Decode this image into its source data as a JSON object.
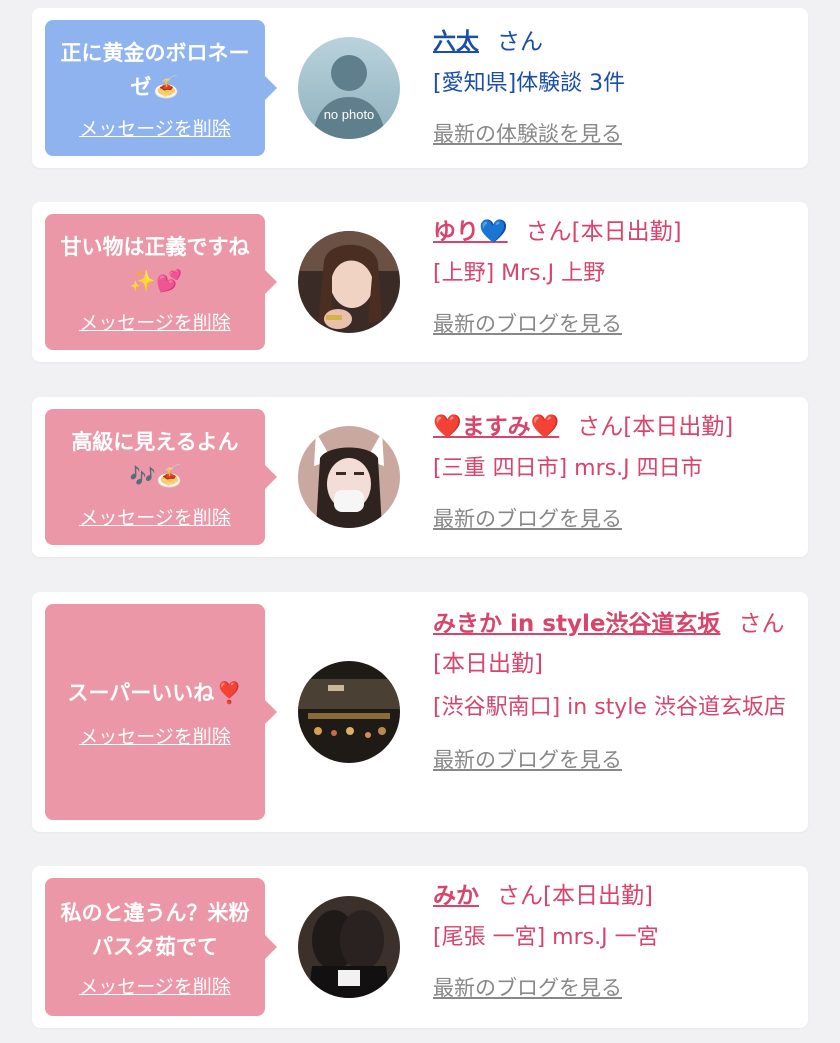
{
  "colors": {
    "blue_bubble": "#8fb3ee",
    "pink_bubble": "#eb97a7",
    "blue_text": "#1a4ea8",
    "pink_text": "#d8446b",
    "gray_link": "#888888",
    "background": "#f1f1f3"
  },
  "cards": [
    {
      "message": "正に黄金のボロネーゼ",
      "message_emoji": "🍝",
      "delete_label": "メッセージを削除",
      "name": "六太",
      "san": "さん",
      "location": "[愛知県]体験談 3件",
      "latest_label": "最新の体験談を見る",
      "avatar_icon": "no-photo-silhouette-icon",
      "avatar_text": "no photo"
    },
    {
      "message": "甘い物は正義ですね",
      "message_emoji": "✨💕",
      "delete_label": "メッセージを削除",
      "name": "ゆり💙",
      "san": "さん[本日出勤]",
      "location": "[上野] Mrs.J 上野",
      "latest_label": "最新のブログを見る",
      "avatar_icon": "profile-photo-icon"
    },
    {
      "message": "高級に見えるよん",
      "message_emoji": "🎶🍝",
      "delete_label": "メッセージを削除",
      "name": "❤️ますみ❤️",
      "san": "さん[本日出勤]",
      "location": "[三重 四日市] mrs.J 四日市",
      "latest_label": "最新のブログを見る",
      "avatar_icon": "profile-photo-icon"
    },
    {
      "message": "スーパーいいね",
      "message_emoji": "❣️",
      "delete_label": "メッセージを削除",
      "name": "みきか in style渋谷道玄坂",
      "san": "さん[本日出勤]",
      "location": "[渋谷駅南口] in style 渋谷道玄坂店",
      "latest_label": "最新のブログを見る",
      "avatar_icon": "profile-photo-icon"
    },
    {
      "message": "私のと違うん？米粉パスタ茹でて",
      "message_emoji": "",
      "delete_label": "メッセージを削除",
      "name": "みか",
      "san": "さん[本日出勤]",
      "location": "[尾張 一宮] mrs.J 一宮",
      "latest_label": "最新のブログを見る",
      "avatar_icon": "profile-photo-icon"
    }
  ]
}
